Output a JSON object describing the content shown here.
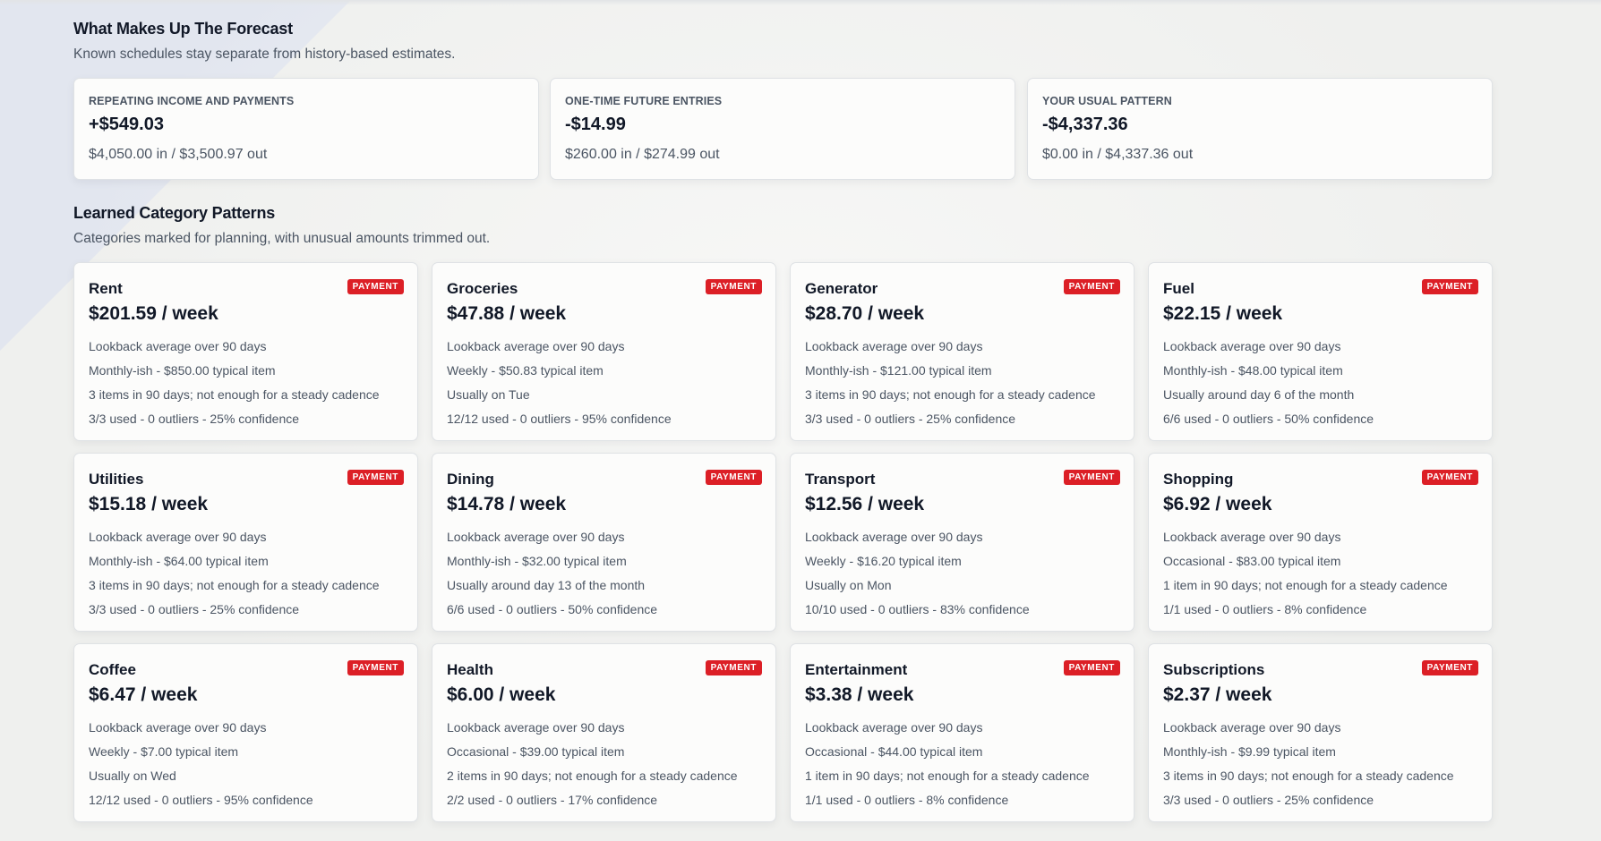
{
  "forecast_breakdown": {
    "title": "What Makes Up The Forecast",
    "subtitle": "Known schedules stay separate from history-based estimates.",
    "cards": [
      {
        "label": "REPEATING INCOME AND PAYMENTS",
        "value": "+$549.03",
        "detail": "$4,050.00 in / $3,500.97 out"
      },
      {
        "label": "ONE-TIME FUTURE ENTRIES",
        "value": "-$14.99",
        "detail": "$260.00 in / $274.99 out"
      },
      {
        "label": "YOUR USUAL PATTERN",
        "value": "-$4,337.36",
        "detail": "$0.00 in / $4,337.36 out"
      }
    ]
  },
  "learned_patterns": {
    "title": "Learned Category Patterns",
    "subtitle": "Categories marked for planning, with unusual amounts trimmed out.",
    "badge_color": "#dc1f26",
    "categories": [
      {
        "name": "Rent",
        "badge": "PAYMENT",
        "amount": "$201.59 / week",
        "lines": [
          "Lookback average over 90 days",
          "Monthly-ish - $850.00 typical item",
          "3 items in 90 days; not enough for a steady cadence",
          "3/3 used - 0 outliers - 25% confidence"
        ]
      },
      {
        "name": "Groceries",
        "badge": "PAYMENT",
        "amount": "$47.88 / week",
        "lines": [
          "Lookback average over 90 days",
          "Weekly - $50.83 typical item",
          "Usually on Tue",
          "12/12 used - 0 outliers - 95% confidence"
        ]
      },
      {
        "name": "Generator",
        "badge": "PAYMENT",
        "amount": "$28.70 / week",
        "lines": [
          "Lookback average over 90 days",
          "Monthly-ish - $121.00 typical item",
          "3 items in 90 days; not enough for a steady cadence",
          "3/3 used - 0 outliers - 25% confidence"
        ]
      },
      {
        "name": "Fuel",
        "badge": "PAYMENT",
        "amount": "$22.15 / week",
        "lines": [
          "Lookback average over 90 days",
          "Monthly-ish - $48.00 typical item",
          "Usually around day 6 of the month",
          "6/6 used - 0 outliers - 50% confidence"
        ]
      },
      {
        "name": "Utilities",
        "badge": "PAYMENT",
        "amount": "$15.18 / week",
        "lines": [
          "Lookback average over 90 days",
          "Monthly-ish - $64.00 typical item",
          "3 items in 90 days; not enough for a steady cadence",
          "3/3 used - 0 outliers - 25% confidence"
        ]
      },
      {
        "name": "Dining",
        "badge": "PAYMENT",
        "amount": "$14.78 / week",
        "lines": [
          "Lookback average over 90 days",
          "Monthly-ish - $32.00 typical item",
          "Usually around day 13 of the month",
          "6/6 used - 0 outliers - 50% confidence"
        ]
      },
      {
        "name": "Transport",
        "badge": "PAYMENT",
        "amount": "$12.56 / week",
        "lines": [
          "Lookback average over 90 days",
          "Weekly - $16.20 typical item",
          "Usually on Mon",
          "10/10 used - 0 outliers - 83% confidence"
        ]
      },
      {
        "name": "Shopping",
        "badge": "PAYMENT",
        "amount": "$6.92 / week",
        "lines": [
          "Lookback average over 90 days",
          "Occasional - $83.00 typical item",
          "1 item in 90 days; not enough for a steady cadence",
          "1/1 used - 0 outliers - 8% confidence"
        ]
      },
      {
        "name": "Coffee",
        "badge": "PAYMENT",
        "amount": "$6.47 / week",
        "lines": [
          "Lookback average over 90 days",
          "Weekly - $7.00 typical item",
          "Usually on Wed",
          "12/12 used - 0 outliers - 95% confidence"
        ]
      },
      {
        "name": "Health",
        "badge": "PAYMENT",
        "amount": "$6.00 / week",
        "lines": [
          "Lookback average over 90 days",
          "Occasional - $39.00 typical item",
          "2 items in 90 days; not enough for a steady cadence",
          "2/2 used - 0 outliers - 17% confidence"
        ]
      },
      {
        "name": "Entertainment",
        "badge": "PAYMENT",
        "amount": "$3.38 / week",
        "lines": [
          "Lookback average over 90 days",
          "Occasional - $44.00 typical item",
          "1 item in 90 days; not enough for a steady cadence",
          "1/1 used - 0 outliers - 8% confidence"
        ]
      },
      {
        "name": "Subscriptions",
        "badge": "PAYMENT",
        "amount": "$2.37 / week",
        "lines": [
          "Lookback average over 90 days",
          "Monthly-ish - $9.99 typical item",
          "3 items in 90 days; not enough for a steady cadence",
          "3/3 used - 0 outliers - 25% confidence"
        ]
      }
    ]
  }
}
